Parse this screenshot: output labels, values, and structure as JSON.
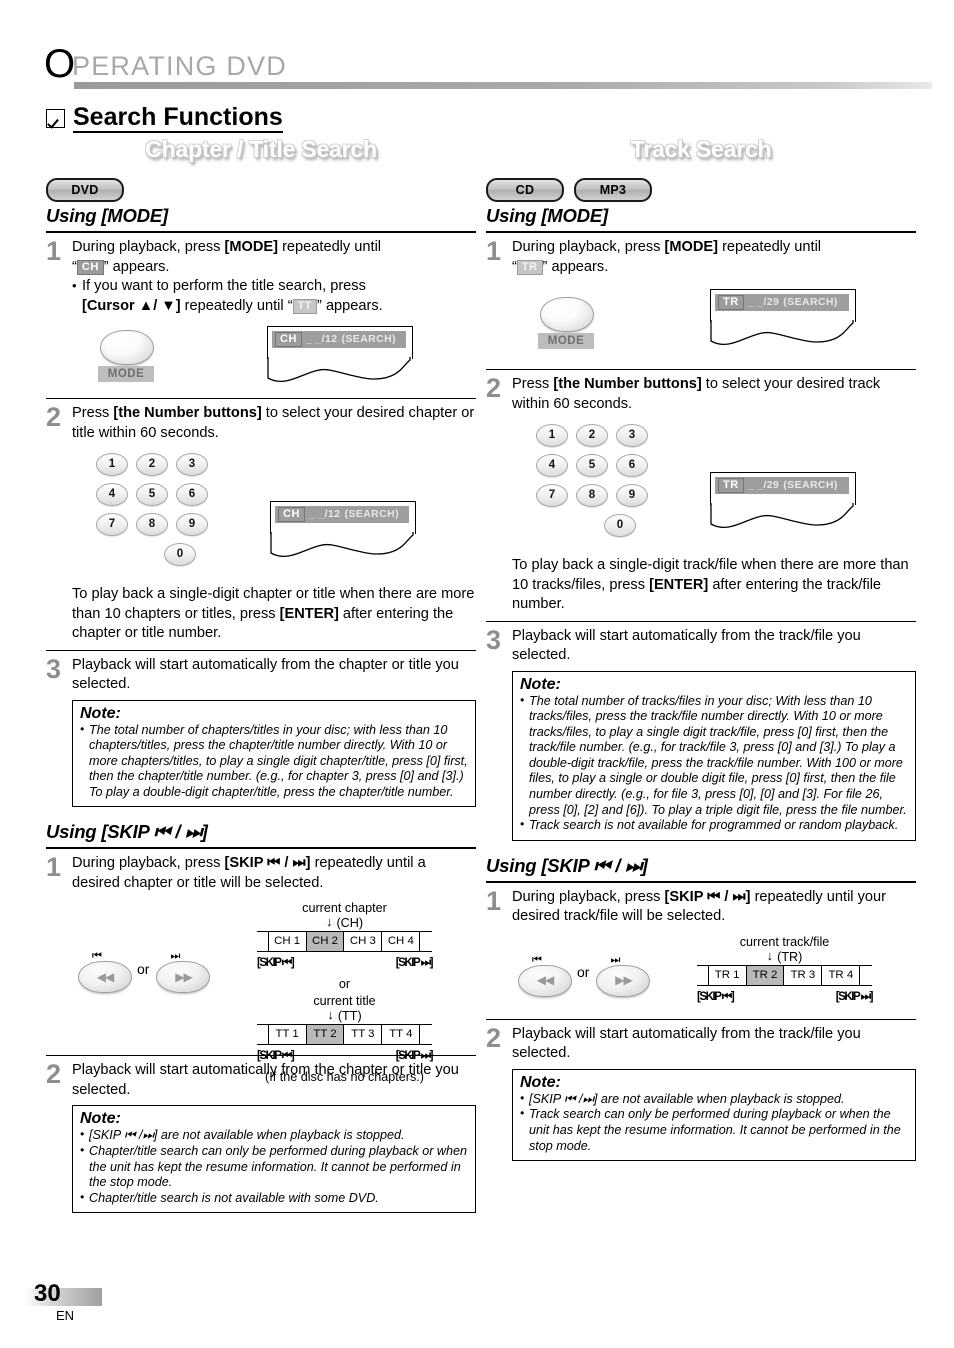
{
  "running_head": {
    "first_letter": "O",
    "rest": "PERATING  DVD"
  },
  "main_heading": "Search Functions",
  "footer": {
    "page_number": "30",
    "language": "EN"
  },
  "left_column": {
    "section_title": "Chapter / Title Search",
    "badges": [
      "DVD"
    ],
    "mode_section": {
      "heading": "Using [MODE]",
      "step1": {
        "num": "1",
        "line1_a": "During playback, press ",
        "line1_b": "[MODE]",
        "line1_c": " repeatedly until",
        "line2_a": "“",
        "line2_chip": "CH",
        "line2_b": "” appears.",
        "bullet_a": "If you want to perform the title search, press",
        "bullet_b": "[Cursor ▲/ ▼]",
        "bullet_c": " repeatedly until “",
        "bullet_chip": "TT",
        "bullet_d": "” appears.",
        "button_label": "MODE",
        "osd": {
          "chip": "CH",
          "value": "_ _/12",
          "state": "(SEARCH)"
        }
      },
      "step2": {
        "num": "2",
        "line_a": "Press ",
        "line_b": "[the Number buttons]",
        "line_c": " to select your desired chapter or title within 60 seconds.",
        "numpad": [
          "1",
          "2",
          "3",
          "4",
          "5",
          "6",
          "7",
          "8",
          "9",
          "0"
        ],
        "osd": {
          "chip": "CH",
          "value": "_ _/12",
          "state": "(SEARCH)"
        },
        "tail_a": "To play back a single-digit chapter or title when there are more than 10 chapters or titles, press ",
        "tail_b": "[ENTER]",
        "tail_c": " after entering the chapter or title number."
      },
      "step3": {
        "num": "3",
        "text": "Playback will start automatically from the chapter or title you selected."
      },
      "note": {
        "title": "Note:",
        "items": [
          "The total number of chapters/titles in your disc; with less than 10 chapters/titles, press the chapter/title number directly. With 10 or more chapters/titles, to play a single digit chapter/title, press [0] first, then the chapter/title number. (e.g., for chapter 3, press [0] and [3].) To play a double-digit chapter/title, press the chapter/title number."
        ]
      }
    },
    "skip_section": {
      "heading": "Using [SKIP ⏮ / ⏭]",
      "step1": {
        "num": "1",
        "line_a": "During playback, press ",
        "line_b": "[SKIP ⏮ / ⏭]",
        "line_c": " repeatedly until a desired chapter or title will be selected.",
        "or_label": "or",
        "diagram": {
          "caption1_top": "current chapter",
          "caption1_sub": "(CH)",
          "cells1": [
            "CH 1",
            "CH 2",
            "CH 3",
            "CH 4"
          ],
          "highlight1": 1,
          "left_label": "[SKIP ⏮]",
          "right_label": "[SKIP ⏭]",
          "middle_or": "or",
          "caption2_top": "current title",
          "caption2_sub": "(TT)",
          "cells2": [
            "TT 1",
            "TT 2",
            "TT 3",
            "TT 4"
          ],
          "highlight2": 1,
          "footnote": "(If the disc has no chapters.)"
        }
      },
      "step2": {
        "num": "2",
        "text": "Playback will start automatically from the chapter or title you selected."
      },
      "note": {
        "title": "Note:",
        "items": [
          "[SKIP ⏮ /⏭] are not available when playback is stopped.",
          "Chapter/title search can only be performed during playback or when the unit has kept the resume information. It cannot be performed in the stop mode.",
          "Chapter/title search is not available with some DVD."
        ]
      }
    }
  },
  "right_column": {
    "section_title": "Track Search",
    "badges": [
      "CD",
      "MP3"
    ],
    "mode_section": {
      "heading": "Using [MODE]",
      "step1": {
        "num": "1",
        "line1_a": "During playback, press ",
        "line1_b": "[MODE]",
        "line1_c": " repeatedly until",
        "line2_a": "“",
        "line2_chip": "TR",
        "line2_b": "” appears.",
        "button_label": "MODE",
        "osd": {
          "chip": "TR",
          "value": "_ _/29",
          "state": "(SEARCH)"
        }
      },
      "step2": {
        "num": "2",
        "line_a": "Press ",
        "line_b": "[the Number buttons]",
        "line_c": " to select your desired track within 60 seconds.",
        "numpad": [
          "1",
          "2",
          "3",
          "4",
          "5",
          "6",
          "7",
          "8",
          "9",
          "0"
        ],
        "osd": {
          "chip": "TR",
          "value": "_ _/29",
          "state": "(SEARCH)"
        },
        "tail_a": "To play back a single-digit track/file when there are more than 10 tracks/files, press ",
        "tail_b": "[ENTER]",
        "tail_c": " after entering the track/file number."
      },
      "step3": {
        "num": "3",
        "text": "Playback will start automatically from the track/file you selected."
      },
      "note": {
        "title": "Note:",
        "items": [
          "The total number of tracks/files in your disc; With less than 10 tracks/files, press the track/file number directly. With 10 or more tracks/files, to play a single digit track/file, press [0] first, then the track/file number. (e.g., for track/file 3, press [0] and [3].)  To play a double-digit track/file, press the track/file number. With 100 or more files, to play a single or double digit file, press [0] first, then the file number directly. (e.g., for file 3, press [0], [0] and [3]. For file 26, press [0], [2] and [6]). To play a triple digit file, press the file number.",
          "Track search is not available for programmed or random playback."
        ]
      }
    },
    "skip_section": {
      "heading": "Using [SKIP ⏮ / ⏭]",
      "step1": {
        "num": "1",
        "line_a": "During playback, press ",
        "line_b": "[SKIP ⏮ / ⏭]",
        "line_c": " repeatedly until your desired track/file will be selected.",
        "or_label": "or",
        "diagram": {
          "caption1_top": "current track/file",
          "caption1_sub": "(TR)",
          "cells1": [
            "TR 1",
            "TR 2",
            "TR 3",
            "TR 4"
          ],
          "highlight1": 1,
          "left_label": "[SKIP ⏮]",
          "right_label": "[SKIP ⏭]"
        }
      },
      "step2": {
        "num": "2",
        "text": "Playback will start automatically from the track/file you selected."
      },
      "note": {
        "title": "Note:",
        "items": [
          "[SKIP ⏮ /⏭] are not available when playback is stopped.",
          "Track search can only be performed during playback or when the unit has kept the resume information. It cannot be performed in the stop mode."
        ]
      }
    }
  }
}
